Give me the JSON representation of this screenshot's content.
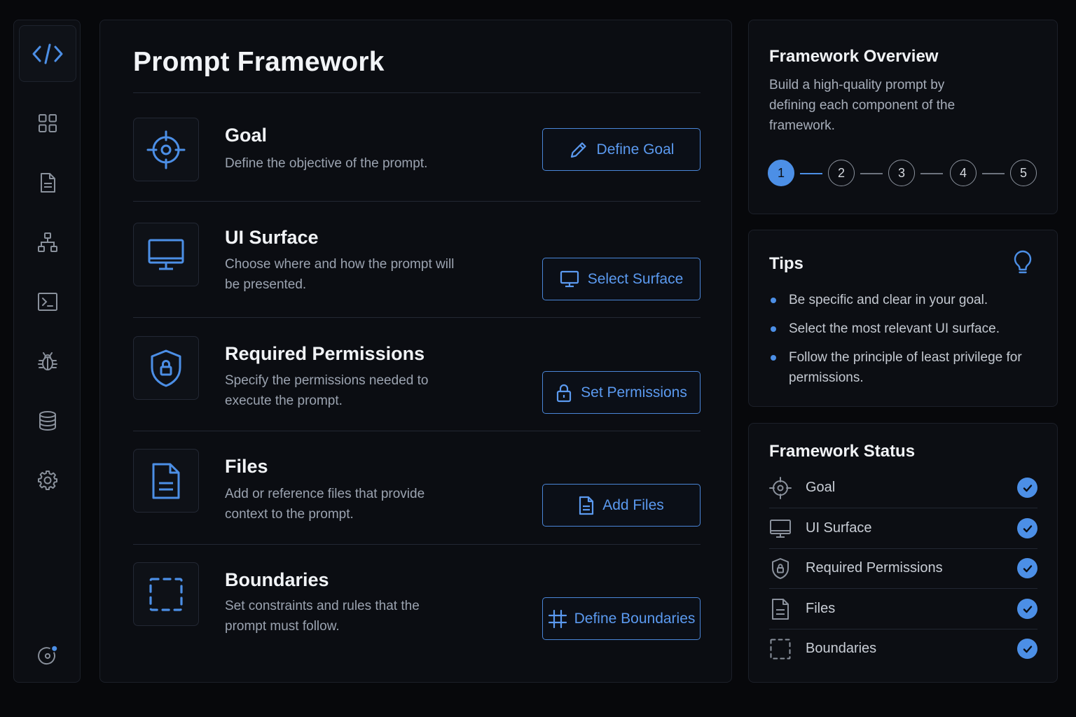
{
  "page": {
    "title": "Prompt Framework"
  },
  "sidebar": {
    "items": [
      {
        "icon": "code-icon",
        "active": true
      },
      {
        "icon": "grid-icon"
      },
      {
        "icon": "document-icon"
      },
      {
        "icon": "hierarchy-icon"
      },
      {
        "icon": "terminal-icon"
      },
      {
        "icon": "bug-icon"
      },
      {
        "icon": "database-icon"
      },
      {
        "icon": "gear-icon"
      },
      {
        "icon": "notification-icon"
      }
    ]
  },
  "components": [
    {
      "title": "Goal",
      "description": "Define the objective of the prompt.",
      "button": "Define Goal",
      "icon": "target-icon",
      "button_icon": "pencil-icon"
    },
    {
      "title": "UI Surface",
      "description": "Choose where and how the prompt will be presented.",
      "button": "Select Surface",
      "icon": "monitor-icon",
      "button_icon": "monitor-icon"
    },
    {
      "title": "Required Permissions",
      "description": "Specify the permissions needed to execute the prompt.",
      "button": "Set Permissions",
      "icon": "shield-lock-icon",
      "button_icon": "lock-icon"
    },
    {
      "title": "Files",
      "description": "Add or reference files that provide context to the prompt.",
      "button": "Add Files",
      "icon": "file-icon",
      "button_icon": "file-icon"
    },
    {
      "title": "Boundaries",
      "description": "Set constraints and rules that the prompt must follow.",
      "button": "Define Boundaries",
      "icon": "dashed-square-icon",
      "button_icon": "hashtag-icon"
    }
  ],
  "overview": {
    "title": "Framework Overview",
    "text": "Build a high-quality prompt by defining each component of the framework.",
    "steps": [
      "1",
      "2",
      "3",
      "4",
      "5"
    ],
    "active_step": "1"
  },
  "tips": {
    "title": "Tips",
    "icon": "lightbulb-icon",
    "items": [
      "Be specific and clear in your goal.",
      "Select the most relevant UI surface.",
      "Follow the principle of least privilege for permissions."
    ]
  },
  "status": {
    "title": "Framework Status",
    "items": [
      {
        "label": "Goal",
        "icon": "target-icon",
        "complete": true
      },
      {
        "label": "UI Surface",
        "icon": "monitor-icon",
        "complete": true
      },
      {
        "label": "Required Permissions",
        "icon": "shield-lock-icon",
        "complete": true
      },
      {
        "label": "Files",
        "icon": "file-icon",
        "complete": true
      },
      {
        "label": "Boundaries",
        "icon": "dashed-square-icon",
        "complete": true
      }
    ]
  },
  "colors": {
    "accent": "#4c8fe6",
    "background": "#07080b",
    "panel": "#0b0d12"
  }
}
